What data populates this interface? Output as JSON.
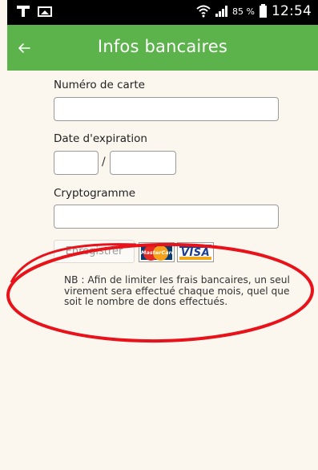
{
  "status_bar": {
    "battery_pct": "85 %",
    "time": "12:54",
    "icons": [
      "usb-icon",
      "image-icon",
      "wifi-icon",
      "signal-icon",
      "battery-icon"
    ]
  },
  "header": {
    "back_glyph": "←",
    "title": "Infos bancaires",
    "color": "#5cb34b"
  },
  "form": {
    "card_number_label": "Numéro de carte",
    "card_number_value": "",
    "expiry_label": "Date d'expiration",
    "expiry_month_value": "",
    "expiry_separator": "/",
    "expiry_year_value": "",
    "cvv_label": "Cryptogramme",
    "cvv_value": "",
    "submit_label": "Enregistrer"
  },
  "card_logos": {
    "mastercard": "MasterCard",
    "visa": "VISA"
  },
  "note": "NB : Afin de limiter les frais bancaires, un seul virement sera effectué chaque mois, quel que soit le nombre de dons effectués.",
  "annotation": {
    "color": "#e8121a"
  }
}
